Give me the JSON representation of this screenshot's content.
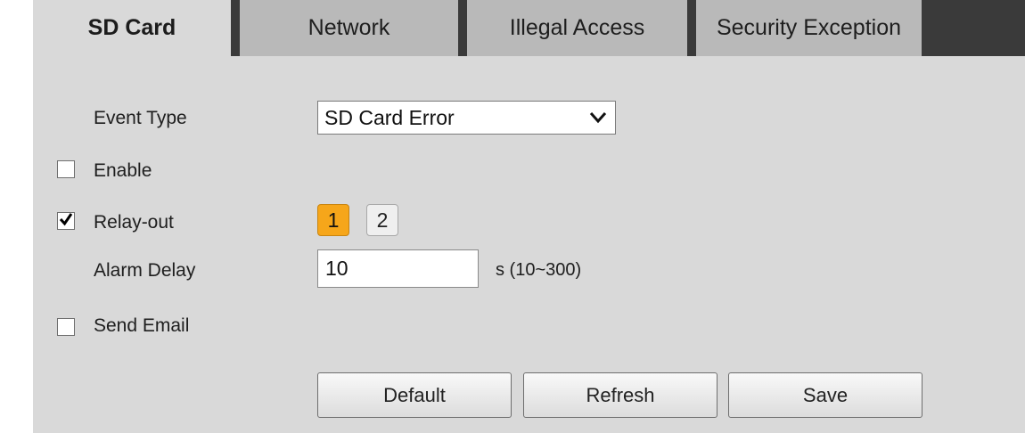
{
  "tabs": [
    {
      "label": "SD Card",
      "active": true
    },
    {
      "label": "Network",
      "active": false
    },
    {
      "label": "Illegal Access",
      "active": false
    },
    {
      "label": "Security Exception",
      "active": false
    }
  ],
  "form": {
    "event_type": {
      "label": "Event Type",
      "value": "SD Card Error"
    },
    "enable": {
      "label": "Enable",
      "checked": false
    },
    "relay_out": {
      "label": "Relay-out",
      "checked": true,
      "channels": [
        "1",
        "2"
      ],
      "selected": "1"
    },
    "alarm_delay": {
      "label": "Alarm Delay",
      "value": "10",
      "unit": "s (10~300)"
    },
    "send_email": {
      "label": "Send Email",
      "checked": false
    }
  },
  "buttons": {
    "default": "Default",
    "refresh": "Refresh",
    "save": "Save"
  },
  "colors": {
    "panel": "#d9d9d9",
    "tab_inactive": "#b9b9b9",
    "separator": "#3a3a3a",
    "relay_active": "#f6a61a"
  },
  "icons": {
    "dropdown": "chevron-down-icon",
    "check": "checkmark-icon"
  }
}
